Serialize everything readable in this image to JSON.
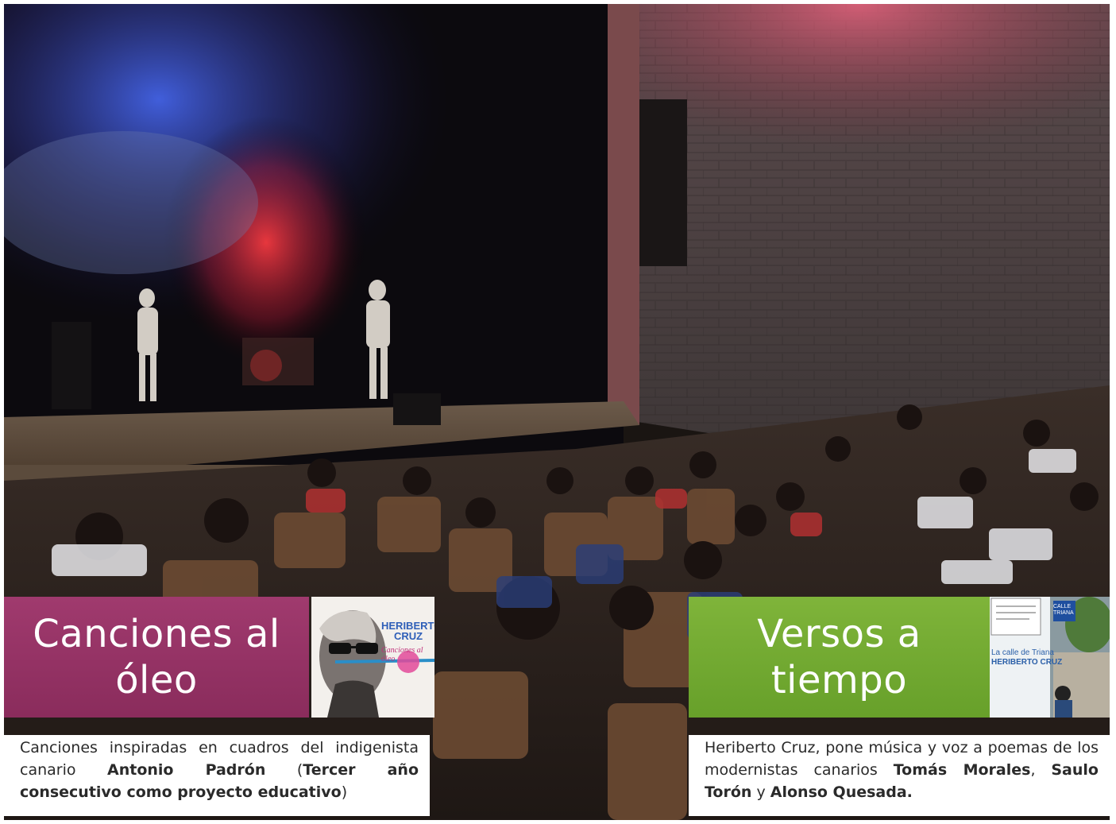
{
  "left_block": {
    "title_line1": "Canciones al",
    "title_line2": "óleo",
    "cover": {
      "artist_line1": "HERIBERTO",
      "artist_line2": "CRUZ",
      "album": "Canciones al óleo"
    },
    "description": {
      "text1": "Canciones inspiradas en cuadros del indigenista canario ",
      "bold1": "Antonio Padrón",
      "text2": " (",
      "bold2": "Tercer año consecutivo como proyecto educativo",
      "text3": ")"
    },
    "accent_color": "#a03a6e"
  },
  "right_block": {
    "title_line1": "Versos a",
    "title_line2": "tiempo",
    "cover": {
      "title": "La calle de Triana",
      "artist": "HERIBERTO CRUZ",
      "sign": "CALLE TRIANA"
    },
    "description": {
      "text1": "Heriberto Cruz, pone música y voz a poemas de los modernistas canarios ",
      "bold1": "Tomás Morales",
      "text2": ", ",
      "bold2": "Saulo Torón",
      "text3": " y ",
      "bold3": "Alonso Quesada.",
      "text4": ""
    },
    "accent_color": "#7fb43a"
  }
}
